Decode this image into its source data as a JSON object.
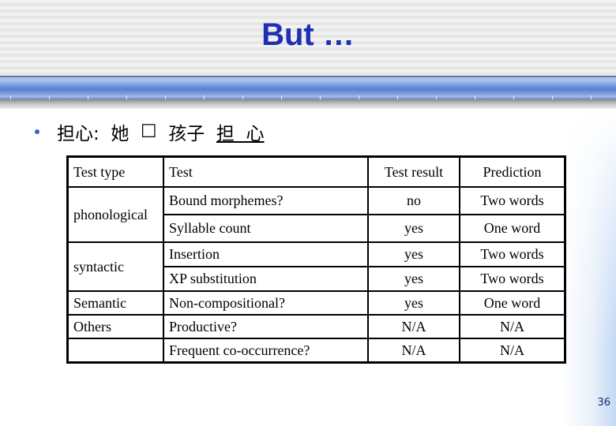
{
  "slide": {
    "title": "But …",
    "page_number": "36"
  },
  "bullet": {
    "prefix": "担心:  她  ",
    "box_char": "☐",
    "middle": "  孩子  ",
    "underlined": "担  心"
  },
  "table": {
    "headers": [
      "Test type",
      "Test",
      "Test result",
      "Prediction"
    ],
    "groups": [
      {
        "type": "phonological",
        "rows": [
          {
            "test": "Bound morphemes?",
            "result": "no",
            "prediction": "Two words"
          },
          {
            "test": "Syllable count",
            "result": "yes",
            "prediction": "One word"
          }
        ]
      },
      {
        "type": "syntactic",
        "rows": [
          {
            "test": "Insertion",
            "result": "yes",
            "prediction": "Two words"
          },
          {
            "test": "XP substitution",
            "result": "yes",
            "prediction": "Two words"
          }
        ]
      },
      {
        "type": "Semantic",
        "rows": [
          {
            "test": "Non-compositional?",
            "result": "yes",
            "prediction": "One word"
          }
        ]
      },
      {
        "type": "Others",
        "rows": [
          {
            "test": "Productive?",
            "result": "N/A",
            "prediction": "N/A"
          }
        ]
      },
      {
        "type": "",
        "rows": [
          {
            "test": "Frequent co-occurrence?",
            "result": "N/A",
            "prediction": "N/A"
          }
        ]
      }
    ]
  },
  "colors": {
    "title": "#1f2fb4",
    "bullet": "#3b5fc4",
    "bar": "#5a80d0"
  }
}
